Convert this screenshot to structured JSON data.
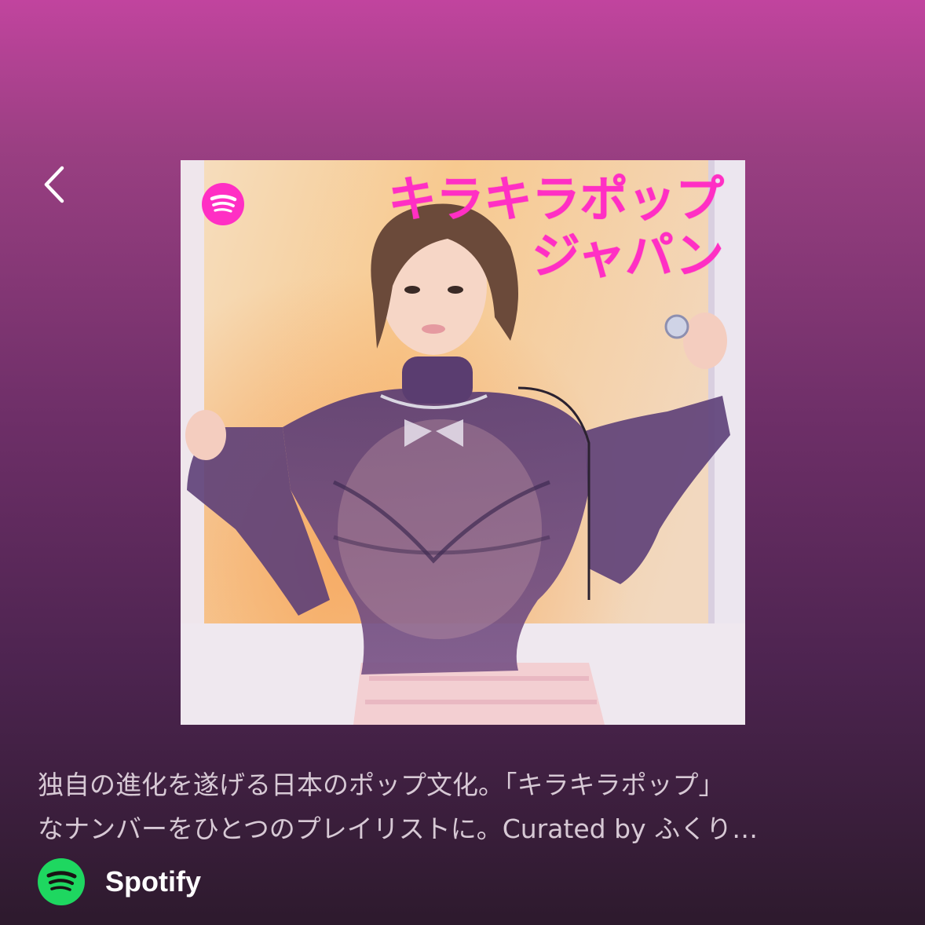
{
  "header": {
    "back_icon": "chevron-left-icon"
  },
  "playlist": {
    "cover": {
      "logo_icon": "spotify-logo-icon",
      "title_lines": [
        "キラキラポップ",
        "ジャパン"
      ],
      "title_color": "#ff2fc4"
    },
    "description_lines": [
      "独自の進化を遂げる日本のポップ文化。「キラキラポップ」",
      "なナンバーをひとつのプレイリストに。Curated by ふくり…"
    ]
  },
  "footer": {
    "brand_icon": "spotify-logo-icon",
    "brand_name": "Spotify",
    "brand_color": "#1ed760"
  },
  "colors": {
    "background_top": "#c1449e",
    "background_bottom": "#2d1a2d",
    "text_muted": "#d7c9d5"
  }
}
